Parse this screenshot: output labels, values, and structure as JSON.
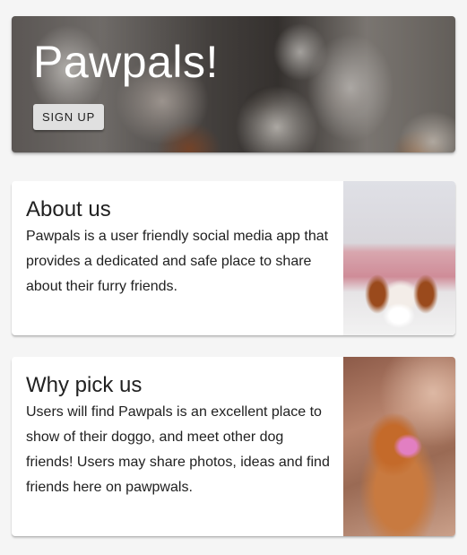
{
  "hero": {
    "title": "Pawpals!",
    "signup_label": "SIGN UP"
  },
  "cards": [
    {
      "title": "About us",
      "text": "Pawpals is a user friendly social media app that provides a dedicated and safe place to share about their furry friends."
    },
    {
      "title": "Why pick us",
      "text": "Users will find Pawpals is an excellent place to show of their doggo, and meet other dog friends! Users may share photos, ideas and find friends here on pawpwals."
    }
  ],
  "colors": {
    "background": "#f5f5f5",
    "card": "#ffffff",
    "button": "#e0e0e0",
    "hero_text": "#ffffff"
  }
}
